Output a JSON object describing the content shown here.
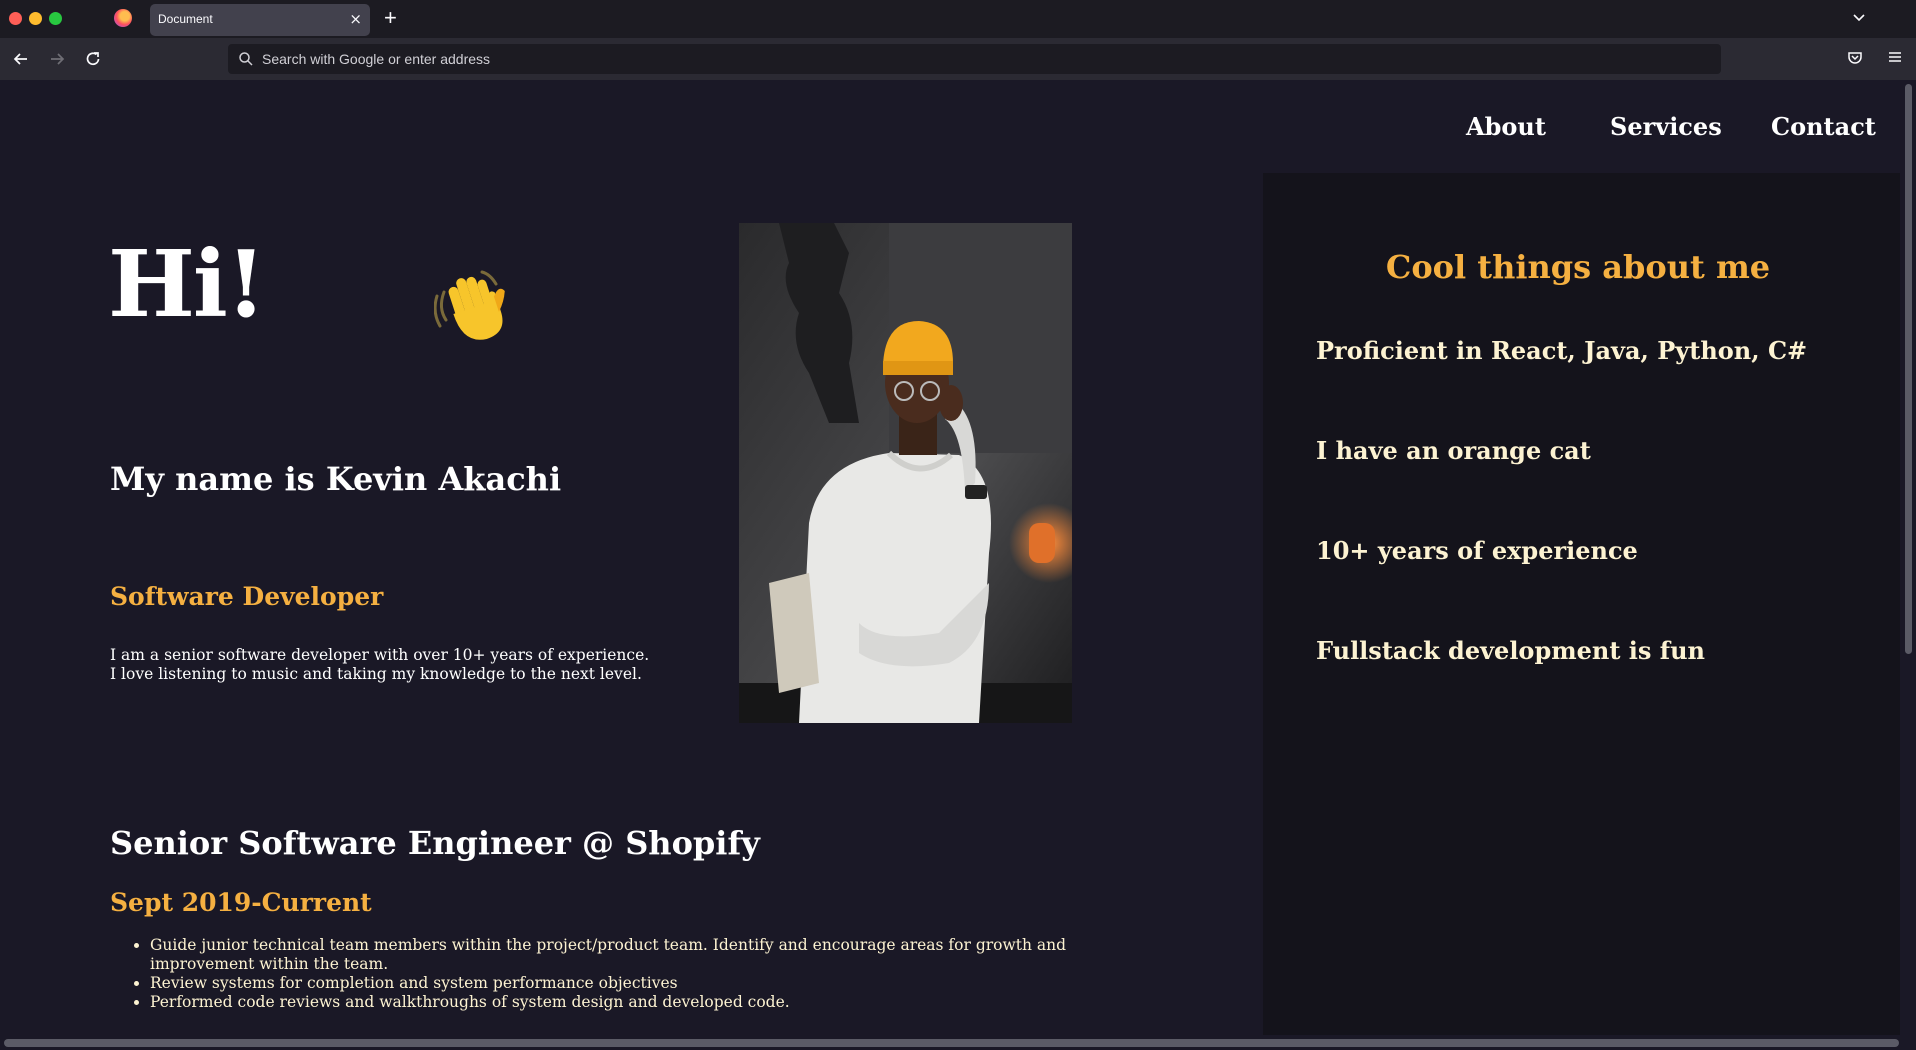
{
  "browser": {
    "tab_title": "Document",
    "tab_close": "×",
    "new_tab": "+",
    "url_placeholder": "Search with Google or enter address"
  },
  "nav": {
    "about": "About",
    "services": "Services",
    "contact": "Contact"
  },
  "hero": {
    "greeting": "Hi!",
    "wave_icon": "waving-hand-emoji",
    "name": "My name is Kevin Akachi",
    "role": "Software Developer",
    "bio": "I am a senior software developer with over 10+ years of experience. I love listening to music and taking my knowledge to the next level."
  },
  "job": {
    "title": "Senior Software Engineer @ Shopify",
    "date": "Sept 2019-Current",
    "bullets": [
      "Guide junior technical team members within the project/product team. Identify and encourage areas for growth and improvement within the team.",
      "Review systems for completion and system performance objectives",
      "Performed code reviews and walkthroughs of system design and developed code."
    ]
  },
  "side": {
    "title": "Cool things about me",
    "facts": [
      "Proficient in React, Java, Python, C#",
      "I have an orange cat",
      "10+ years of experience",
      "Fullstack development is fun"
    ]
  },
  "colors": {
    "accent": "#f5b041",
    "cream": "#fdf3d2",
    "page_bg": "#1a1826",
    "side_bg": "#14131b"
  }
}
